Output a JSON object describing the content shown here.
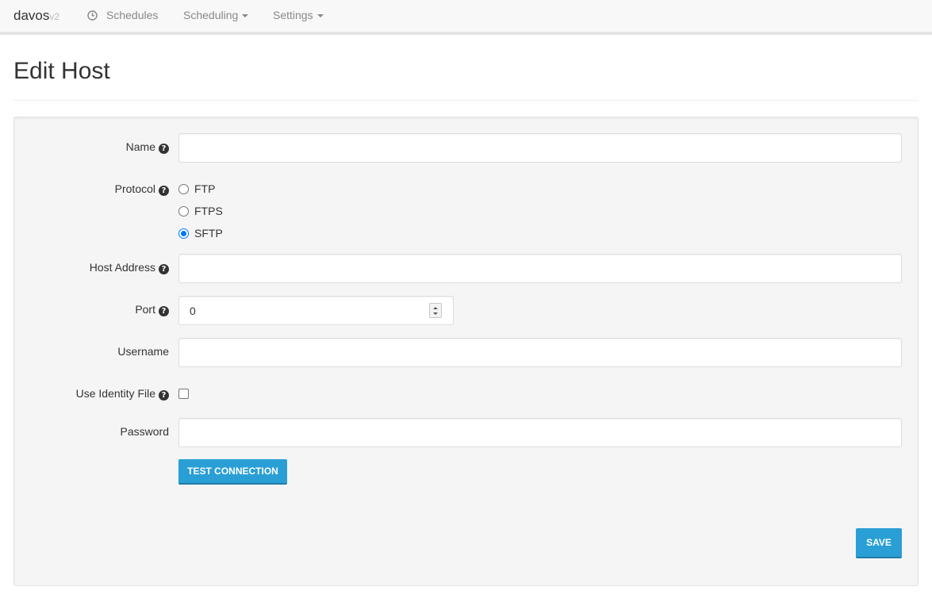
{
  "navbar": {
    "brand": "davos",
    "brand_version": "v2",
    "items": [
      {
        "label": "Schedules",
        "icon": "clock-icon"
      },
      {
        "label": "Scheduling",
        "dropdown": true
      },
      {
        "label": "Settings",
        "dropdown": true
      }
    ]
  },
  "page": {
    "title": "Edit Host"
  },
  "form": {
    "name_label": "Name",
    "name_value": "",
    "protocol_label": "Protocol",
    "protocol_options": [
      "FTP",
      "FTPS",
      "SFTP"
    ],
    "protocol_selected": "SFTP",
    "host_address_label": "Host Address",
    "host_address_value": "",
    "port_label": "Port",
    "port_value": "0",
    "username_label": "Username",
    "username_value": "",
    "use_identity_file_label": "Use Identity File",
    "use_identity_file_checked": false,
    "password_label": "Password",
    "password_value": "",
    "test_connection_label": "TEST CONNECTION",
    "save_label": "SAVE"
  },
  "colors": {
    "accent": "#2a9fd6",
    "radio_selected": "#0075ff"
  }
}
